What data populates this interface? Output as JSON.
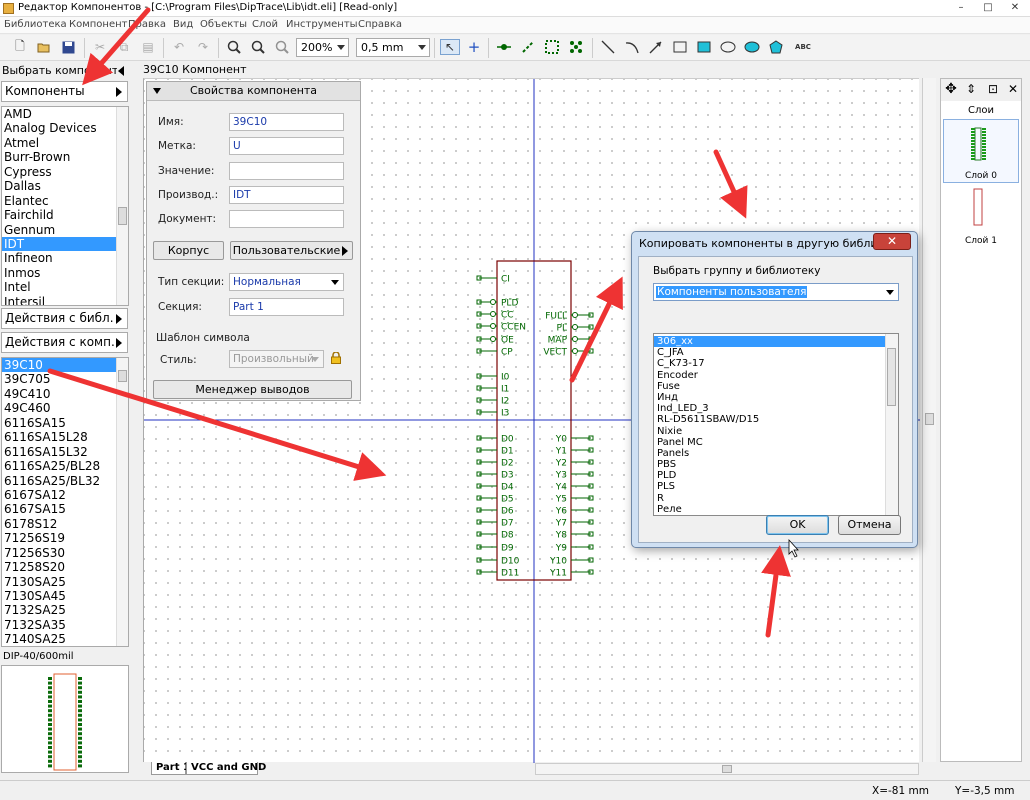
{
  "window": {
    "title": "Редактор Компонентов - [C:\\Program Files\\DipTrace\\Lib\\idt.eli] [Read-only]",
    "min_icon": "minimize-icon",
    "max_icon": "maximize-icon",
    "close_icon": "close-icon"
  },
  "menu": [
    "Библиотека",
    "Компонент",
    "Правка",
    "Вид",
    "Объекты",
    "Слой",
    "Инструменты",
    "Справка"
  ],
  "toolbar": {
    "zoom": "200%",
    "line_width": "0,5 mm"
  },
  "left": {
    "choose_component_label": "Выбрать компонент",
    "components_button": "Компоненты",
    "libraries": [
      "AMD",
      "Analog Devices",
      "Atmel",
      "Burr-Brown",
      "Cypress",
      "Dallas",
      "Elantec",
      "Fairchild",
      "Gennum",
      "IDT",
      "Infineon",
      "Inmos",
      "Intel",
      "Intersil"
    ],
    "selected_library": "IDT",
    "lib_actions": "Действия с библ.",
    "comp_actions": "Действия с комп.",
    "components": [
      "39C10",
      "39C705",
      "49C410",
      "49C460",
      "6116SA15",
      "6116SA15L28",
      "6116SA15L32",
      "6116SA25/BL28",
      "6116SA25/BL32",
      "6167SA12",
      "6167SA15",
      "6178S12",
      "71256S19",
      "71256S30",
      "71258S20",
      "7130SA25",
      "7130SA45",
      "7132SA25",
      "7132SA35",
      "7140SA25"
    ],
    "selected_component": "39C10",
    "pattern_name": "DIP-40/600mil"
  },
  "canvas": {
    "header": "39C10 Компонент",
    "tabs": [
      "Part 1",
      "VCC and GND"
    ]
  },
  "props": {
    "title": "Свойства компонента",
    "name_label": "Имя:",
    "name_value": "39C10",
    "refdes_label": "Метка:",
    "refdes_value": "U",
    "value_label": "Значение:",
    "value_value": "",
    "manufacturer_label": "Производ.:",
    "manufacturer_value": "IDT",
    "datasheet_label": "Документ:",
    "datasheet_value": "",
    "pattern_button": "Корпус",
    "custom_button": "Пользовательские",
    "section_type_label": "Тип секции:",
    "section_type_value": "Нормальная",
    "section_label": "Секция:",
    "section_value": "Part 1",
    "symbol_template": "Шаблон символа",
    "style_label": "Стиль:",
    "style_value": "Произвольный",
    "pin_manager": "Менеджер выводов"
  },
  "schematic": {
    "left_pins": [
      "CI",
      "PLD",
      "CC",
      "CCEN",
      "OE",
      "CP",
      "I0",
      "I1",
      "I2",
      "I3",
      "D0",
      "D1",
      "D2",
      "D3",
      "D4",
      "D5",
      "D6",
      "D7",
      "D8",
      "D9",
      "D10",
      "D11"
    ],
    "right_pins_top": [
      "FULL",
      "PL",
      "MAP",
      "VECT"
    ],
    "right_pins_bottom": [
      "Y0",
      "Y1",
      "Y2",
      "Y3",
      "Y4",
      "Y5",
      "Y6",
      "Y7",
      "Y8",
      "Y9",
      "Y10",
      "Y11"
    ]
  },
  "layers": {
    "title": "Слои",
    "items": [
      "Слой 0",
      "Слой 1"
    ]
  },
  "dialog": {
    "title": "Копировать компоненты в другую библиотеку",
    "group_label": "Выбрать группу и библиотеку",
    "group_value": "Компоненты пользователя",
    "items": [
      "306_xx",
      "C_JFA",
      "C_K73-17",
      "Encoder",
      "Fuse",
      "Инд",
      "Ind_LED_3",
      "RL-D5611SBAW/D15",
      "Nixie",
      "Panel MC",
      "Panels",
      "PBS",
      "PLD",
      "PLS",
      "R",
      "Реле"
    ],
    "selected": "306_xx",
    "ok": "OK",
    "cancel": "Отмена"
  },
  "status": {
    "x": "X=-81 mm",
    "y": "Y=-3,5 mm"
  },
  "colors": {
    "accent": "#3399ff",
    "schematic": "#006600",
    "body": "#7a0000",
    "annotation_arrow": "#ee3333"
  }
}
